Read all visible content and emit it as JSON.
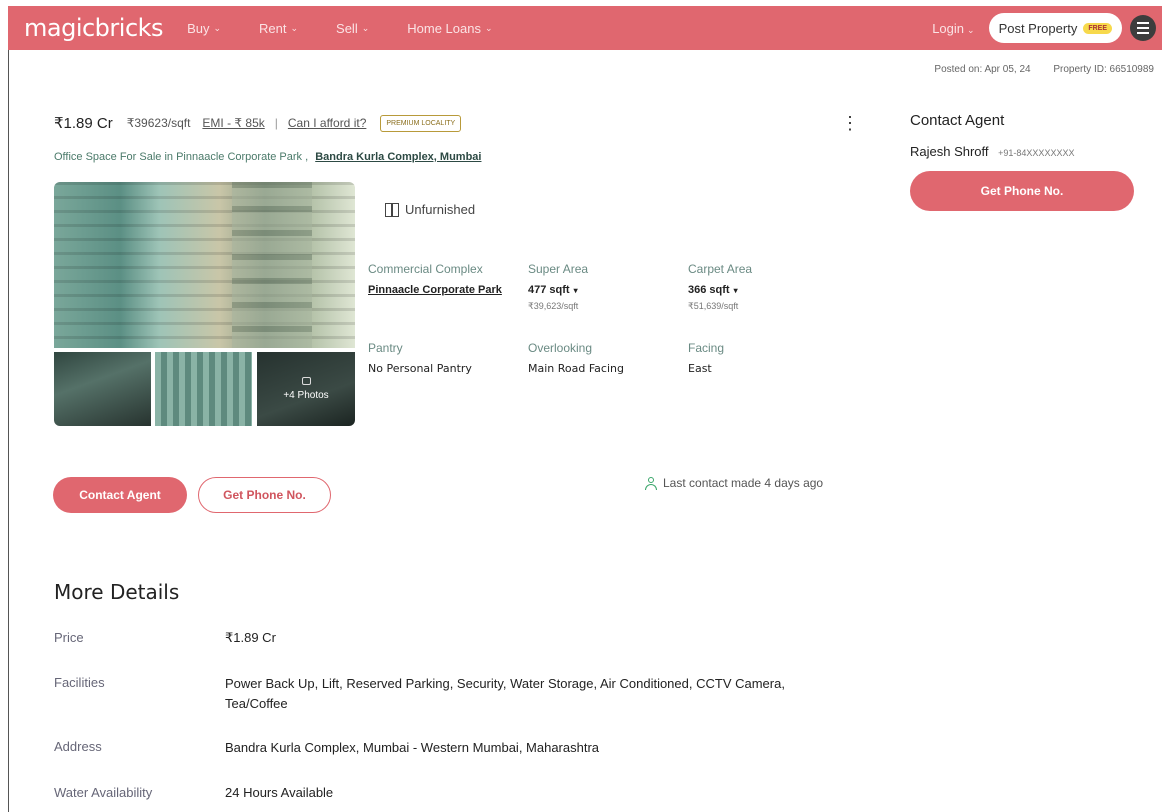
{
  "header": {
    "logo": "magicbricks",
    "nav": [
      {
        "label": "Buy"
      },
      {
        "label": "Rent"
      },
      {
        "label": "Sell"
      },
      {
        "label": "Home Loans"
      }
    ],
    "login": "Login",
    "post_property": "Post Property",
    "free_badge": "FREE",
    "accent_color": "#e0676f"
  },
  "meta": {
    "posted_on": "Posted on: Apr 05, 24",
    "property_id": "Property ID: 66510989"
  },
  "listing": {
    "price": "₹1.89 Cr",
    "price_per_sqft": "₹39623/sqft",
    "emi": "EMI - ₹ 85k",
    "afford": "Can I afford it?",
    "premium_badge": "PREMIUM LOCALITY",
    "title_prefix": "Office Space For Sale in Pinnaacle Corporate Park ,",
    "location": "Bandra Kurla Complex, Mumbai",
    "more_photos": "+4 Photos",
    "furnishing": "Unfurnished",
    "specs": {
      "complex_label": "Commercial Complex",
      "complex_value": "Pinnaacle Corporate Park",
      "super_area_label": "Super Area",
      "super_area_value": "477 sqft",
      "super_area_sub": "₹39,623/sqft",
      "carpet_area_label": "Carpet Area",
      "carpet_area_value": "366 sqft",
      "carpet_area_sub": "₹51,639/sqft",
      "pantry_label": "Pantry",
      "pantry_value": "No Personal Pantry",
      "overlooking_label": "Overlooking",
      "overlooking_value": "Main Road Facing",
      "facing_label": "Facing",
      "facing_value": "East"
    },
    "contact_agent_btn": "Contact Agent",
    "get_phone_btn": "Get Phone No.",
    "last_contact": "Last contact made 4 days ago"
  },
  "agent": {
    "title": "Contact Agent",
    "name": "Rajesh Shroff",
    "phone": "+91-84XXXXXXXX",
    "button": "Get Phone No."
  },
  "more_details": {
    "title": "More Details",
    "rows": [
      {
        "label": "Price",
        "value": "₹1.89 Cr"
      },
      {
        "label": "Facilities",
        "value": "Power Back Up, Lift, Reserved Parking, Security, Water Storage, Air Conditioned, CCTV Camera, Tea/Coffee"
      },
      {
        "label": "Address",
        "value": "Bandra Kurla Complex, Mumbai - Western Mumbai, Maharashtra"
      },
      {
        "label": "Water Availability",
        "value": "24 Hours Available"
      }
    ]
  }
}
